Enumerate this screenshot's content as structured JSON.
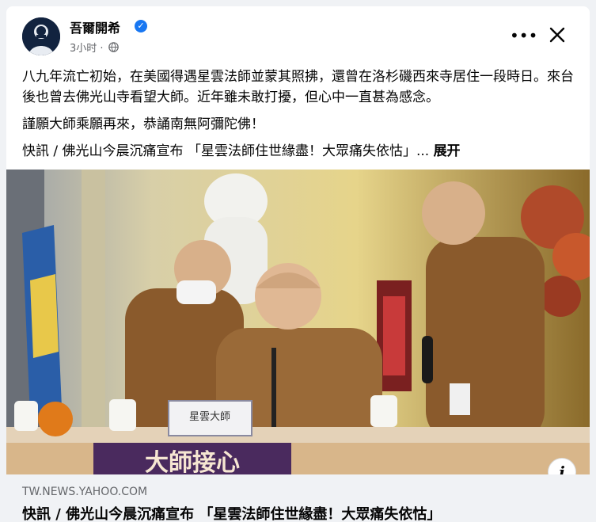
{
  "post": {
    "author": "吾爾開希",
    "timestamp": "3小时",
    "paragraphs": [
      "八九年流亡初始，在美國得遇星雲法師並蒙其照拂，還曾在洛杉磯西來寺居住一段時日。來台後也曾去佛光山寺看望大師。近年雖未敢打擾，但心中一直甚為感念。",
      "謹願大師乘願再來，恭誦南無阿彌陀佛！"
    ],
    "preview_line": "快訊 / 佛光山今晨沉痛宣布 「星雲法師住世緣盡！大眾痛失依怙」...",
    "see_more": "展开"
  },
  "photo": {
    "banner_text": "大師接心",
    "nameplate_text": "星雲大師"
  },
  "link": {
    "domain": "TW.NEWS.YAHOO.COM",
    "title": "快訊 / 佛光山今晨沉痛宣布 「星雲法師住世緣盡！大眾痛失依怙」"
  },
  "icons": {
    "more": "more-horizontal-icon",
    "close": "close-icon",
    "globe": "globe-icon",
    "verified": "verified-badge-icon",
    "info": "info-icon"
  },
  "colors": {
    "background": "#f0f2f5",
    "card": "#ffffff",
    "accent": "#1877f2",
    "secondary_text": "#65676b",
    "robe": "#8a5a2c",
    "banner": "#4a2a5e"
  }
}
